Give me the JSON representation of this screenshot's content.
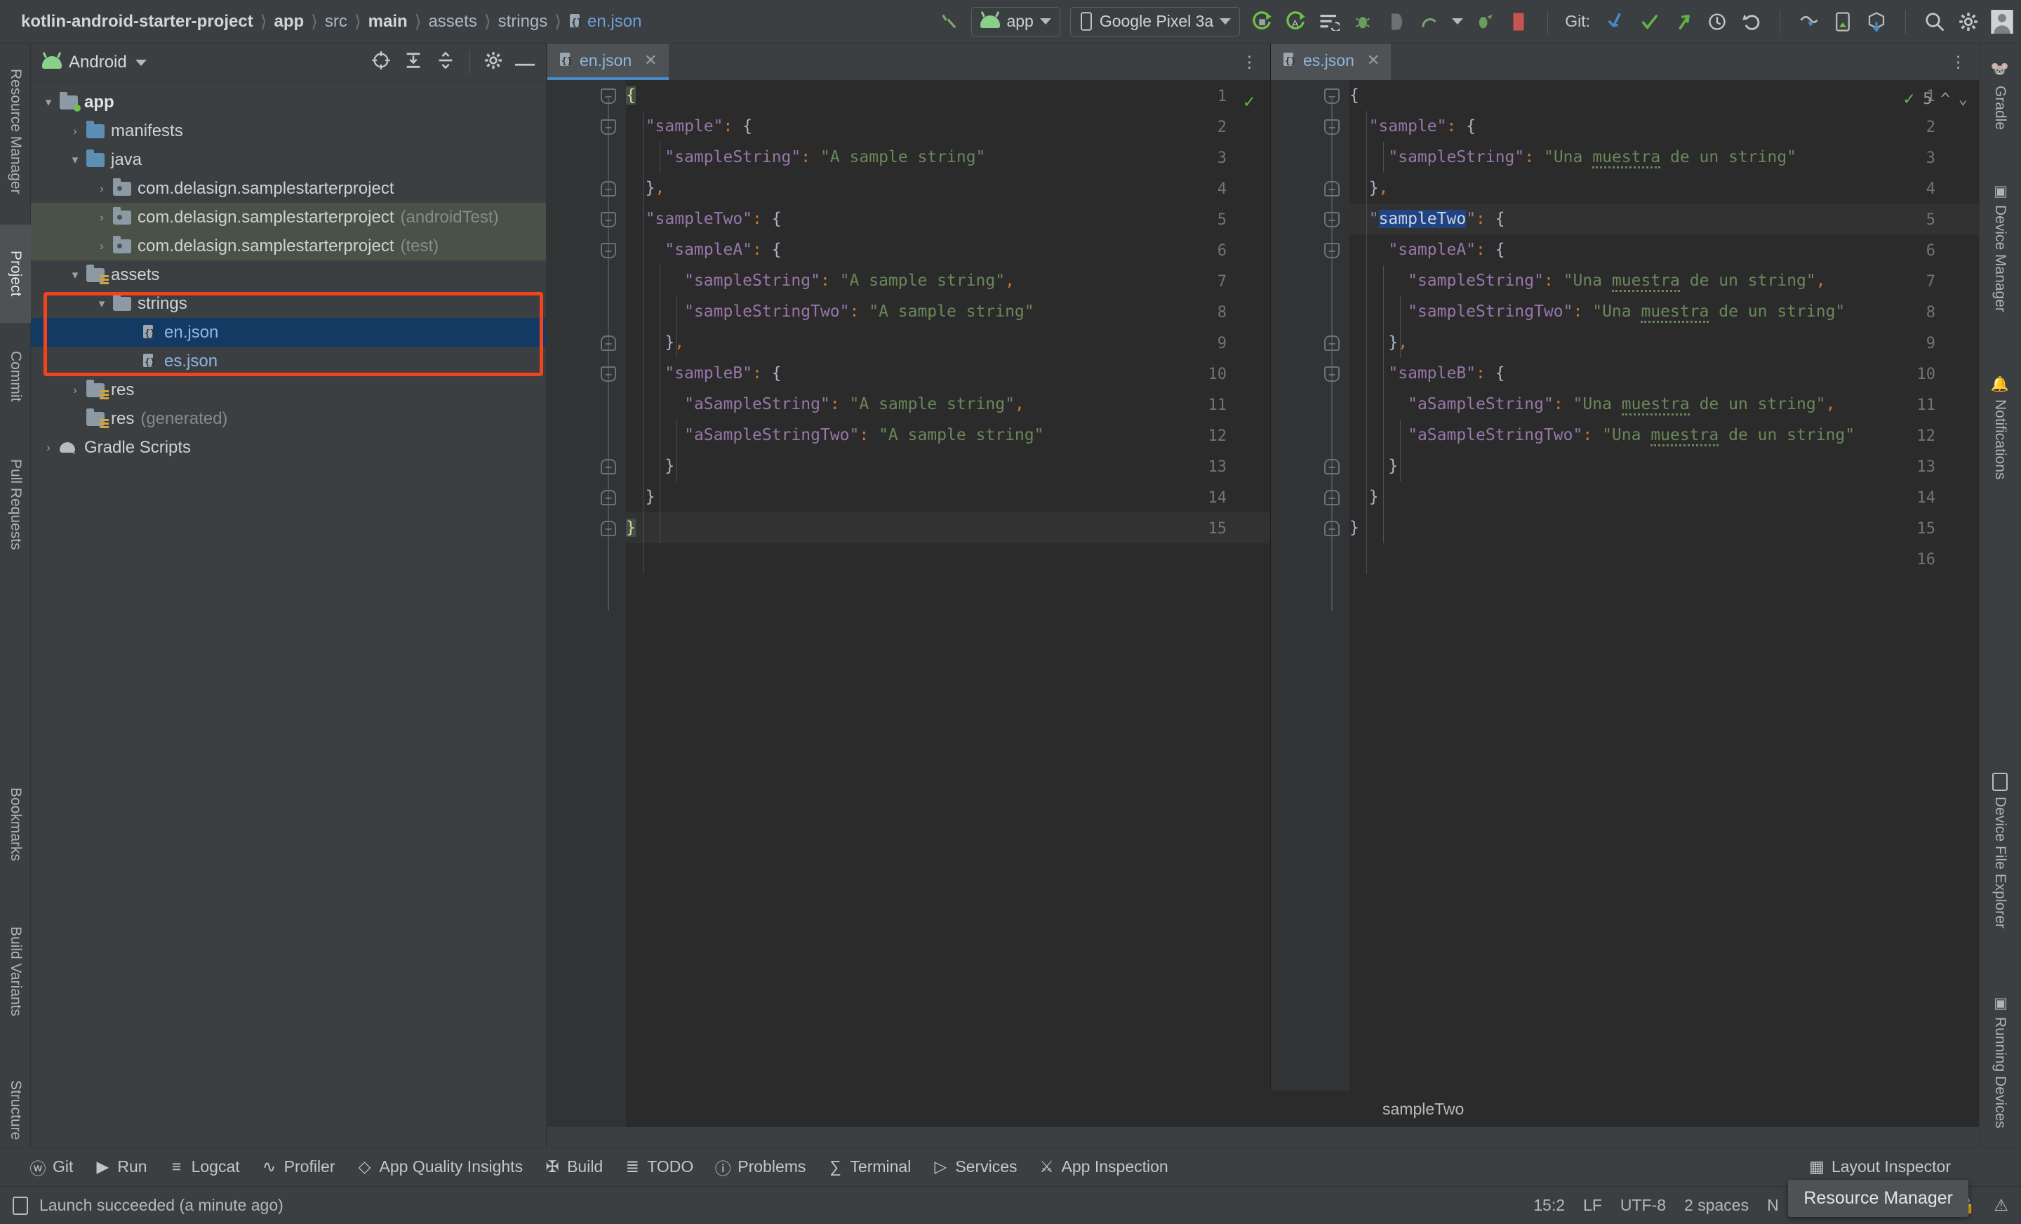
{
  "topbar": {
    "breadcrumb": [
      {
        "label": "kotlin-android-starter-project",
        "bold": true
      },
      {
        "label": "app",
        "bold": true
      },
      {
        "label": "src",
        "bold": false
      },
      {
        "label": "main",
        "bold": true
      },
      {
        "label": "assets",
        "bold": false
      },
      {
        "label": "strings",
        "bold": false
      },
      {
        "label": "en.json",
        "bold": false,
        "file": true
      }
    ],
    "module_selector": "app",
    "device_selector": "Google Pixel 3a",
    "git_label": "Git:",
    "icons": [
      "build-hammer-icon",
      "run-icon",
      "debug-icon",
      "profiler-icon",
      "attach-debugger-icon",
      "coverage-icon",
      "stop-icon",
      "git-update-icon",
      "git-commit-icon",
      "git-push-icon",
      "history-icon",
      "undo-icon",
      "sync-gradle-icon",
      "avd-manager-icon",
      "sdk-manager-icon",
      "search-icon",
      "settings-gear-icon",
      "account-avatar-icon"
    ]
  },
  "left_strip": {
    "tabs": [
      {
        "label": "Resource Manager",
        "selected": false
      },
      {
        "label": "Project",
        "selected": true
      },
      {
        "label": "Commit",
        "selected": false
      },
      {
        "label": "Pull Requests",
        "selected": false
      },
      {
        "label": "Bookmarks",
        "selected": false
      },
      {
        "label": "Build Variants",
        "selected": false
      },
      {
        "label": "Structure",
        "selected": false
      }
    ]
  },
  "project_panel": {
    "title": "Android",
    "toolbar_icons": [
      "locate-target-icon",
      "expand-all-icon",
      "collapse-all-icon",
      "settings-gear-icon",
      "hide-icon"
    ],
    "tree": [
      {
        "label": "app",
        "indent": 0,
        "arrow": "down",
        "icon": "module-folder",
        "bold": true
      },
      {
        "label": "manifests",
        "indent": 1,
        "arrow": "right",
        "icon": "blue-folder"
      },
      {
        "label": "java",
        "indent": 1,
        "arrow": "down",
        "icon": "blue-folder"
      },
      {
        "label": "com.delasign.samplestarterproject",
        "indent": 2,
        "arrow": "right",
        "icon": "package-folder"
      },
      {
        "label": "com.delasign.samplestarterproject",
        "suffix": "(androidTest)",
        "indent": 2,
        "arrow": "right",
        "icon": "package-folder",
        "highlight": "green"
      },
      {
        "label": "com.delasign.samplestarterproject",
        "suffix": "(test)",
        "indent": 2,
        "arrow": "right",
        "icon": "package-folder",
        "highlight": "green"
      },
      {
        "label": "assets",
        "indent": 1,
        "arrow": "down",
        "icon": "res-folder"
      },
      {
        "label": "strings",
        "indent": 2,
        "arrow": "down",
        "icon": "plain-folder"
      },
      {
        "label": "en.json",
        "indent": 3,
        "arrow": "none",
        "icon": "json-file",
        "selected": true,
        "file": true
      },
      {
        "label": "es.json",
        "indent": 3,
        "arrow": "none",
        "icon": "json-file",
        "file": true
      },
      {
        "label": "res",
        "indent": 1,
        "arrow": "right",
        "icon": "res-folder"
      },
      {
        "label": "res",
        "suffix": "(generated)",
        "indent": 1,
        "arrow": "none",
        "icon": "res-folder"
      },
      {
        "label": "Gradle Scripts",
        "indent": 0,
        "arrow": "right",
        "icon": "gradle-elephant"
      }
    ]
  },
  "editor_left": {
    "tab_label": "en.json",
    "inspection_status": "ok",
    "lines": [
      {
        "n": 1,
        "text": "{"
      },
      {
        "n": 2,
        "text": "  \"sample\": {"
      },
      {
        "n": 3,
        "text": "    \"sampleString\": \"A sample string\""
      },
      {
        "n": 4,
        "text": "  },"
      },
      {
        "n": 5,
        "text": "  \"sampleTwo\": {"
      },
      {
        "n": 6,
        "text": "    \"sampleA\": {"
      },
      {
        "n": 7,
        "text": "      \"sampleString\": \"A sample string\","
      },
      {
        "n": 8,
        "text": "      \"sampleStringTwo\": \"A sample string\""
      },
      {
        "n": 9,
        "text": "    },"
      },
      {
        "n": 10,
        "text": "    \"sampleB\": {"
      },
      {
        "n": 11,
        "text": "      \"aSampleString\": \"A sample string\","
      },
      {
        "n": 12,
        "text": "      \"aSampleStringTwo\": \"A sample string\""
      },
      {
        "n": 13,
        "text": "    }"
      },
      {
        "n": 14,
        "text": "  }"
      },
      {
        "n": 15,
        "text": "}"
      }
    ]
  },
  "editor_right": {
    "tab_label": "es.json",
    "warning_count": "5",
    "selected_text": "sampleTwo",
    "breadcrumb": "sampleTwo",
    "lines": [
      {
        "n": 1,
        "text": "{"
      },
      {
        "n": 2,
        "text": "  \"sample\": {"
      },
      {
        "n": 3,
        "text": "    \"sampleString\": \"Una muestra de un string\""
      },
      {
        "n": 4,
        "text": "  },"
      },
      {
        "n": 5,
        "text": "  \"sampleTwo\": {"
      },
      {
        "n": 6,
        "text": "    \"sampleA\": {"
      },
      {
        "n": 7,
        "text": "      \"sampleString\": \"Una muestra de un string\","
      },
      {
        "n": 8,
        "text": "      \"sampleStringTwo\": \"Una muestra de un string\""
      },
      {
        "n": 9,
        "text": "    },"
      },
      {
        "n": 10,
        "text": "    \"sampleB\": {"
      },
      {
        "n": 11,
        "text": "      \"aSampleString\": \"Una muestra de un string\","
      },
      {
        "n": 12,
        "text": "      \"aSampleStringTwo\": \"Una muestra de un string\""
      },
      {
        "n": 13,
        "text": "    }"
      },
      {
        "n": 14,
        "text": "  }"
      },
      {
        "n": 15,
        "text": "}"
      },
      {
        "n": 16,
        "text": ""
      }
    ]
  },
  "right_strip": {
    "tabs": [
      {
        "label": "Gradle",
        "icon": "gradle-elephant-icon"
      },
      {
        "label": "Device Manager",
        "icon": "device-icon"
      },
      {
        "label": "Notifications",
        "icon": "notification-bell-icon"
      },
      {
        "label": "Device File Explorer",
        "icon": "device-file-icon"
      },
      {
        "label": "Running Devices",
        "icon": "running-device-icon"
      }
    ]
  },
  "bottom_bar": {
    "items": [
      {
        "label": "Git",
        "icon": "git-branch-icon"
      },
      {
        "label": "Run",
        "icon": "run-play-icon"
      },
      {
        "label": "Logcat",
        "icon": "logcat-icon"
      },
      {
        "label": "Profiler",
        "icon": "profiler-icon"
      },
      {
        "label": "App Quality Insights",
        "icon": "diamond-icon"
      },
      {
        "label": "Build",
        "icon": "hammer-icon"
      },
      {
        "label": "TODO",
        "icon": "todo-list-icon"
      },
      {
        "label": "Problems",
        "icon": "warning-circle-icon"
      },
      {
        "label": "Terminal",
        "icon": "terminal-icon"
      },
      {
        "label": "Services",
        "icon": "services-play-icon"
      },
      {
        "label": "App Inspection",
        "icon": "inspection-icon"
      }
    ],
    "right_item": {
      "label": "Layout Inspector",
      "icon": "layout-inspector-icon"
    }
  },
  "status_bar": {
    "message": "Launch succeeded (a minute ago)",
    "caret_position": "15:2",
    "line_separator": "LF",
    "encoding": "UTF-8",
    "indent": "2 spaces",
    "read_only_indicator": "N",
    "icons": [
      "lock-icon",
      "notification-icon"
    ]
  },
  "tooltip": {
    "text": "Resource Manager"
  },
  "colors": {
    "background": "#3c3f41",
    "editor_bg": "#2b2b2b",
    "accent_blue": "#4a88c7",
    "selection_blue": "#123a63",
    "highlight_red": "#f1441e",
    "android_green": "#6cc24a",
    "string_green": "#6a8759",
    "key_purple": "#9876aa",
    "punct_orange": "#cc7832",
    "brace_yellow": "#ffc66d"
  }
}
